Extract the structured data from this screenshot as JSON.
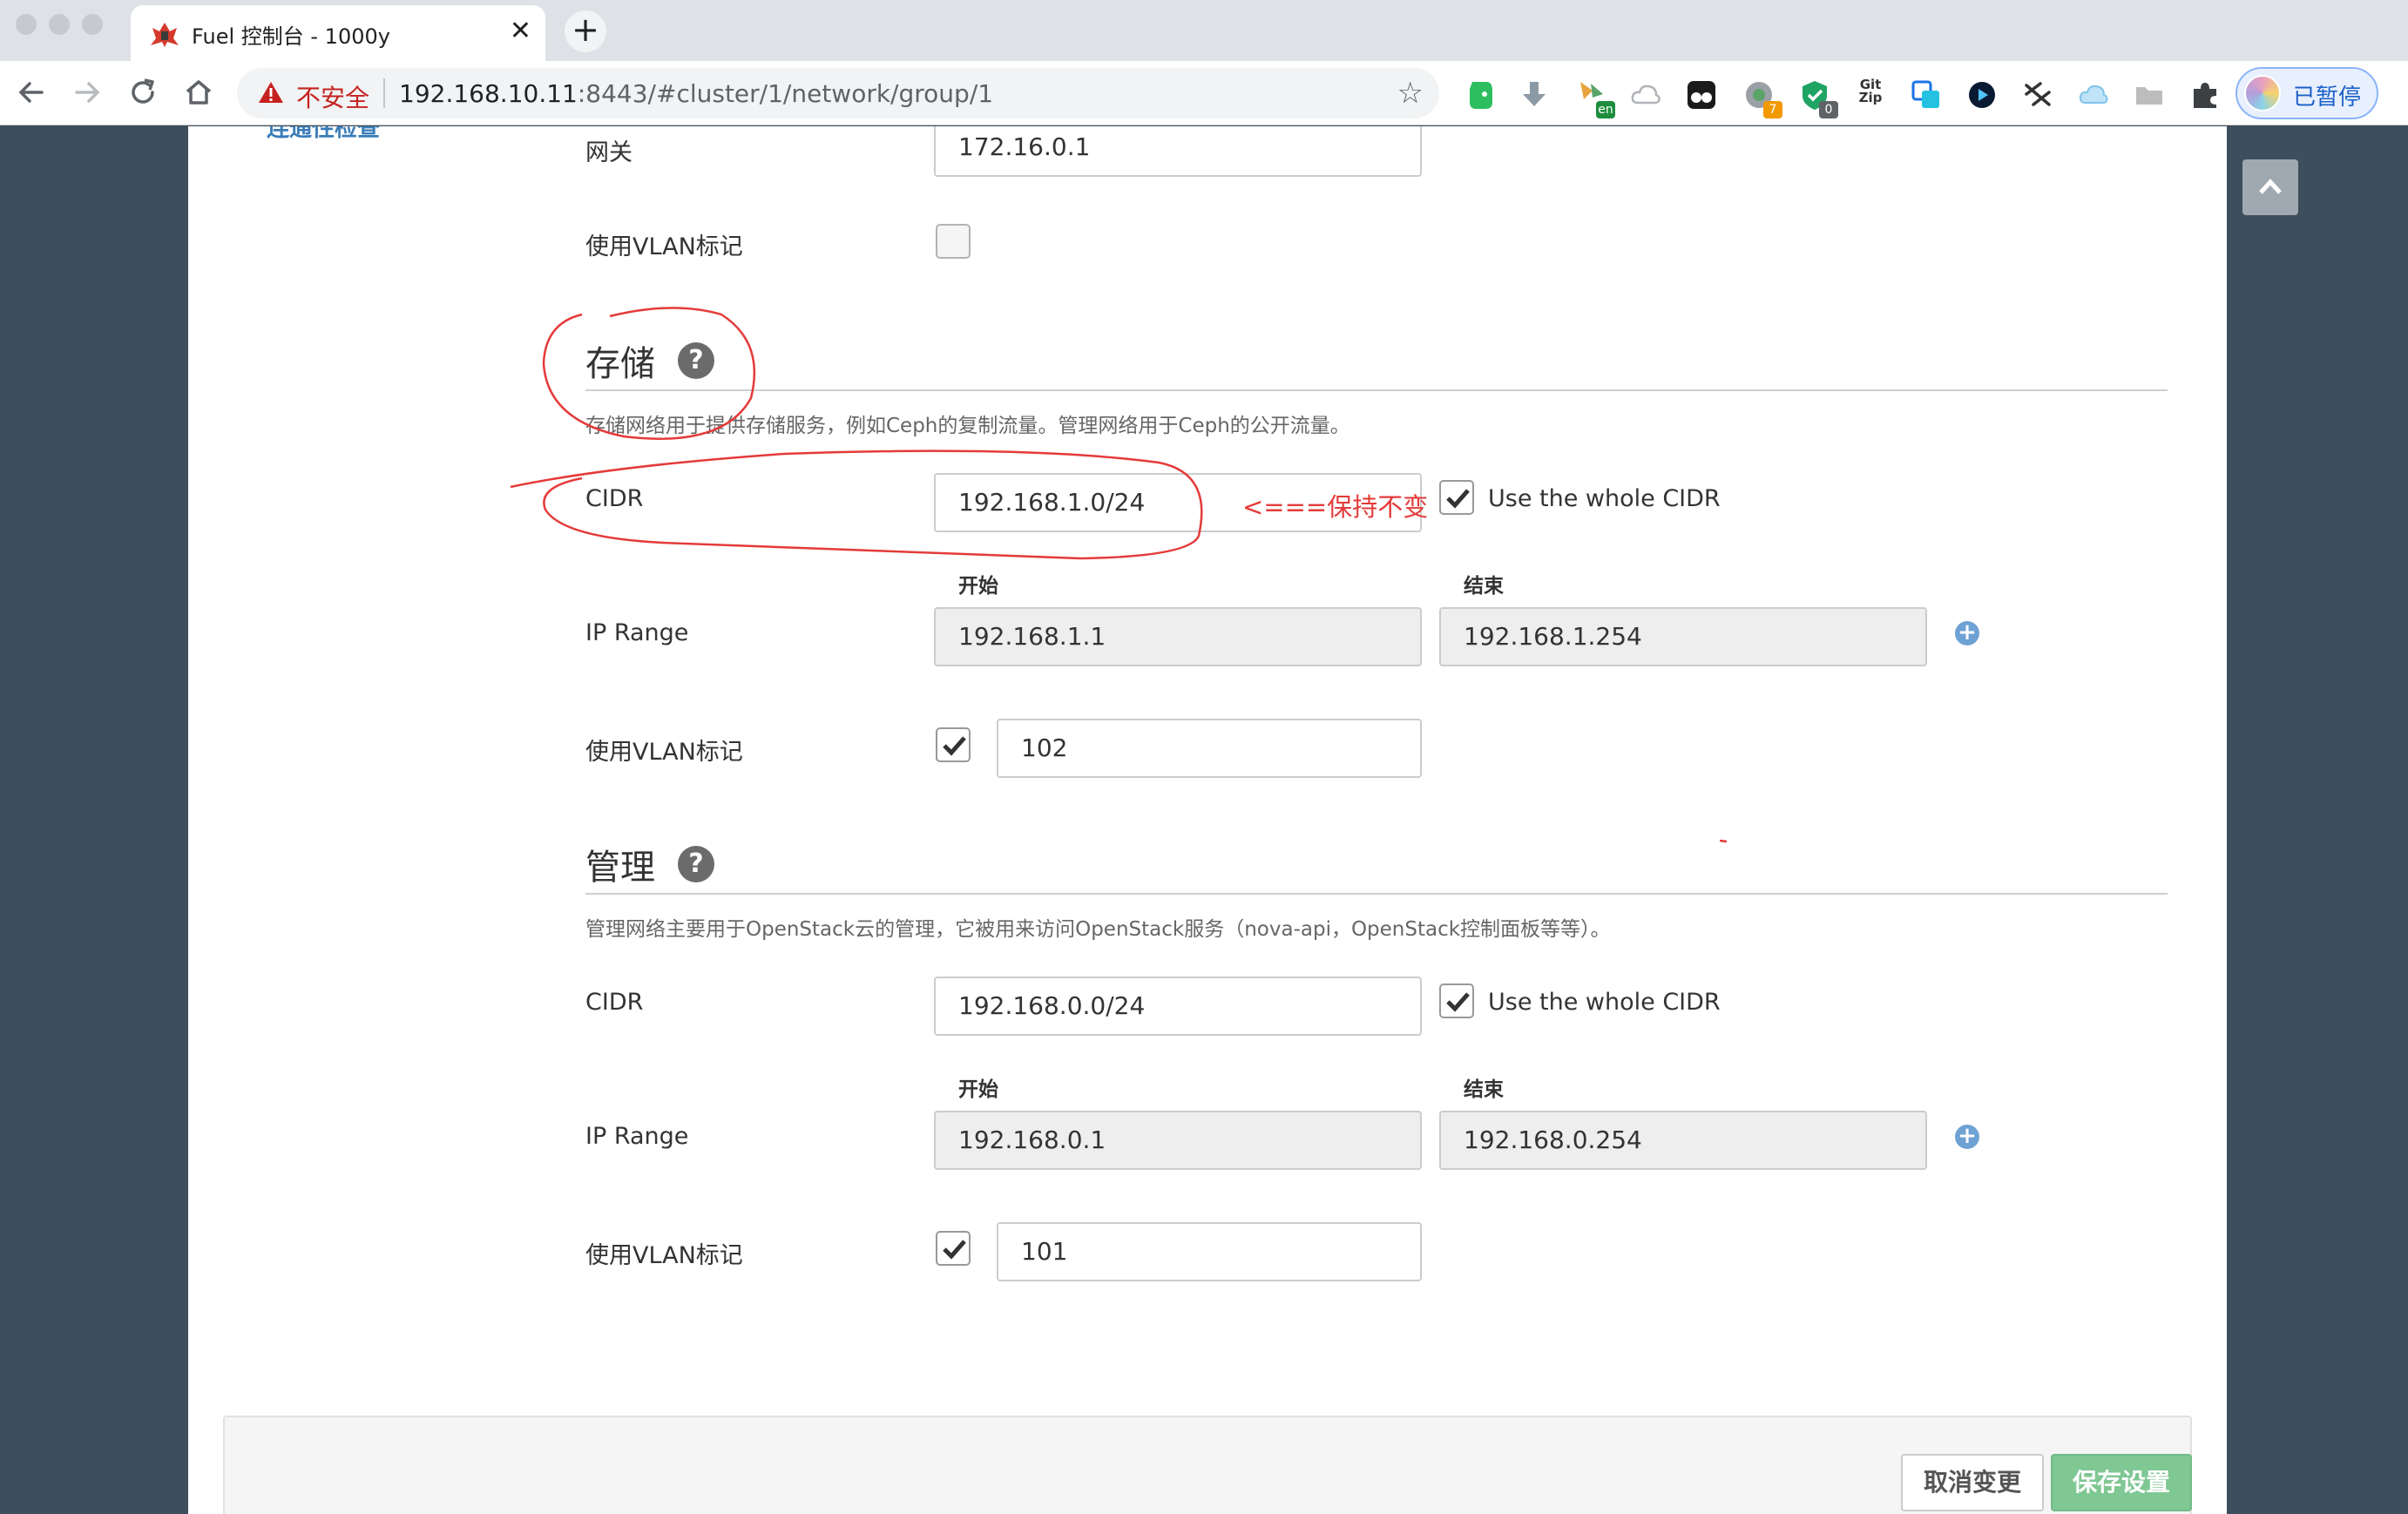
{
  "browser": {
    "tab_title": "Fuel 控制台 - 1000y",
    "tab_close": "✕",
    "new_tab": "+",
    "security_label": "不安全",
    "url_host": "192.168.10.11",
    "url_rest": ":8443/#cluster/1/network/group/1",
    "ext_badge_1": "7",
    "ext_badge_2": "0",
    "ext_badge_en": "en",
    "ext_gitzip": "Git Zip",
    "profile_label": "已暂停"
  },
  "sidebar": {
    "link_label": "连通性检查"
  },
  "gateway_section": {
    "gateway_label": "网关",
    "gateway_value": "172.16.0.1",
    "vlan_label": "使用VLAN标记",
    "vlan_checked": false
  },
  "storage": {
    "title": "存储",
    "description": "存储网络用于提供存储服务，例如Ceph的复制流量。管理网络用于Ceph的公开流量。",
    "cidr_label": "CIDR",
    "cidr_value": "192.168.1.0/24",
    "use_whole_cidr_label": "Use the whole CIDR",
    "use_whole_cidr_checked": true,
    "ip_range_label": "IP Range",
    "start_label": "开始",
    "end_label": "结束",
    "start_value": "192.168.1.1",
    "end_value": "192.168.1.254",
    "vlan_label": "使用VLAN标记",
    "vlan_checked": true,
    "vlan_value": "102"
  },
  "management": {
    "title": "管理",
    "description": "管理网络主要用于OpenStack云的管理，它被用来访问OpenStack服务（nova-api，OpenStack控制面板等等）。",
    "cidr_label": "CIDR",
    "cidr_value": "192.168.0.0/24",
    "use_whole_cidr_label": "Use the whole CIDR",
    "use_whole_cidr_checked": true,
    "ip_range_label": "IP Range",
    "start_label": "开始",
    "end_label": "结束",
    "start_value": "192.168.0.1",
    "end_value": "192.168.0.254",
    "vlan_label": "使用VLAN标记",
    "vlan_checked": true,
    "vlan_value": "101"
  },
  "annotation": {
    "note": "<===保持不变",
    "color": "#e53a3a"
  },
  "footer": {
    "cancel_label": "取消变更",
    "save_label": "保存设置"
  },
  "colors": {
    "page_background": "#3d4e5d",
    "save_button": "#7fc793",
    "link": "#3a7cb8",
    "plus_icon": "#6ea2d4"
  }
}
